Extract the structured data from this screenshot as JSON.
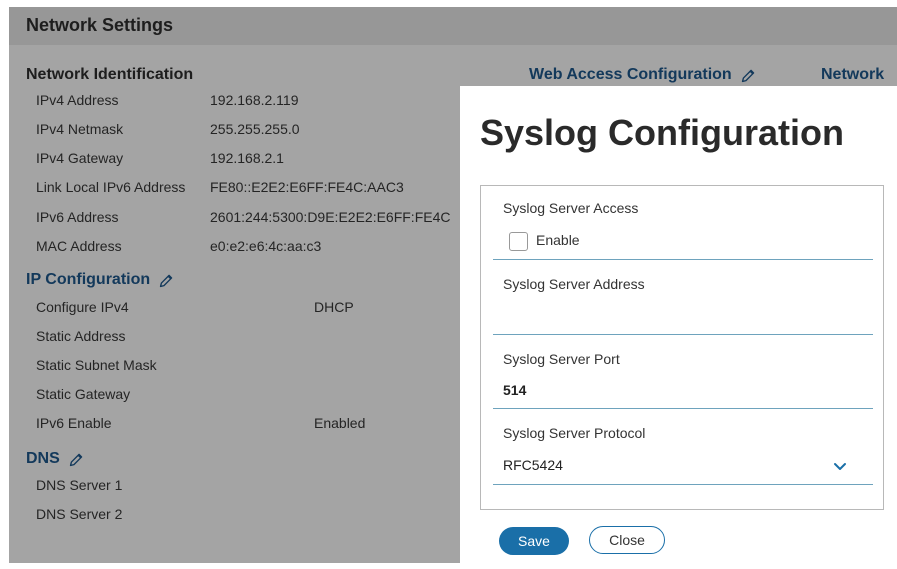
{
  "header": {
    "title": "Network Settings"
  },
  "network_identification": {
    "title": "Network Identification",
    "rows": [
      {
        "label": "IPv4 Address",
        "value": "192.168.2.119"
      },
      {
        "label": "IPv4 Netmask",
        "value": "255.255.255.0"
      },
      {
        "label": "IPv4 Gateway",
        "value": "192.168.2.1"
      },
      {
        "label": "Link Local IPv6 Address",
        "value": "FE80::E2E2:E6FF:FE4C:AAC3"
      },
      {
        "label": "IPv6 Address",
        "value": "2601:244:5300:D9E:E2E2:E6FF:FE4C"
      },
      {
        "label": "MAC Address",
        "value": "e0:e2:e6:4c:aa:c3"
      }
    ]
  },
  "right_links": {
    "web_access": "Web Access Configuration",
    "network": "Network"
  },
  "ip_configuration": {
    "title": "IP Configuration",
    "rows": [
      {
        "label": "Configure IPv4",
        "value": "DHCP"
      },
      {
        "label": "Static Address",
        "value": ""
      },
      {
        "label": "Static Subnet Mask",
        "value": ""
      },
      {
        "label": "Static Gateway",
        "value": ""
      },
      {
        "label": "IPv6 Enable",
        "value": "Enabled"
      }
    ]
  },
  "dns": {
    "title": "DNS",
    "rows": [
      {
        "label": "DNS Server 1"
      },
      {
        "label": "DNS Server 2"
      }
    ]
  },
  "modal": {
    "title": "Syslog Configuration",
    "server_access_label": "Syslog Server Access",
    "enable_label": "Enable",
    "enable_checked": false,
    "server_address_label": "Syslog Server Address",
    "server_address_value": "",
    "server_port_label": "Syslog Server Port",
    "server_port_value": "514",
    "server_protocol_label": "Syslog Server Protocol",
    "server_protocol_value": "RFC5424",
    "save_label": "Save",
    "close_label": "Close"
  },
  "colors": {
    "accent": "#1a6fa8",
    "section_blue": "#1b4f7f",
    "field_underline": "#6ea3bd"
  }
}
